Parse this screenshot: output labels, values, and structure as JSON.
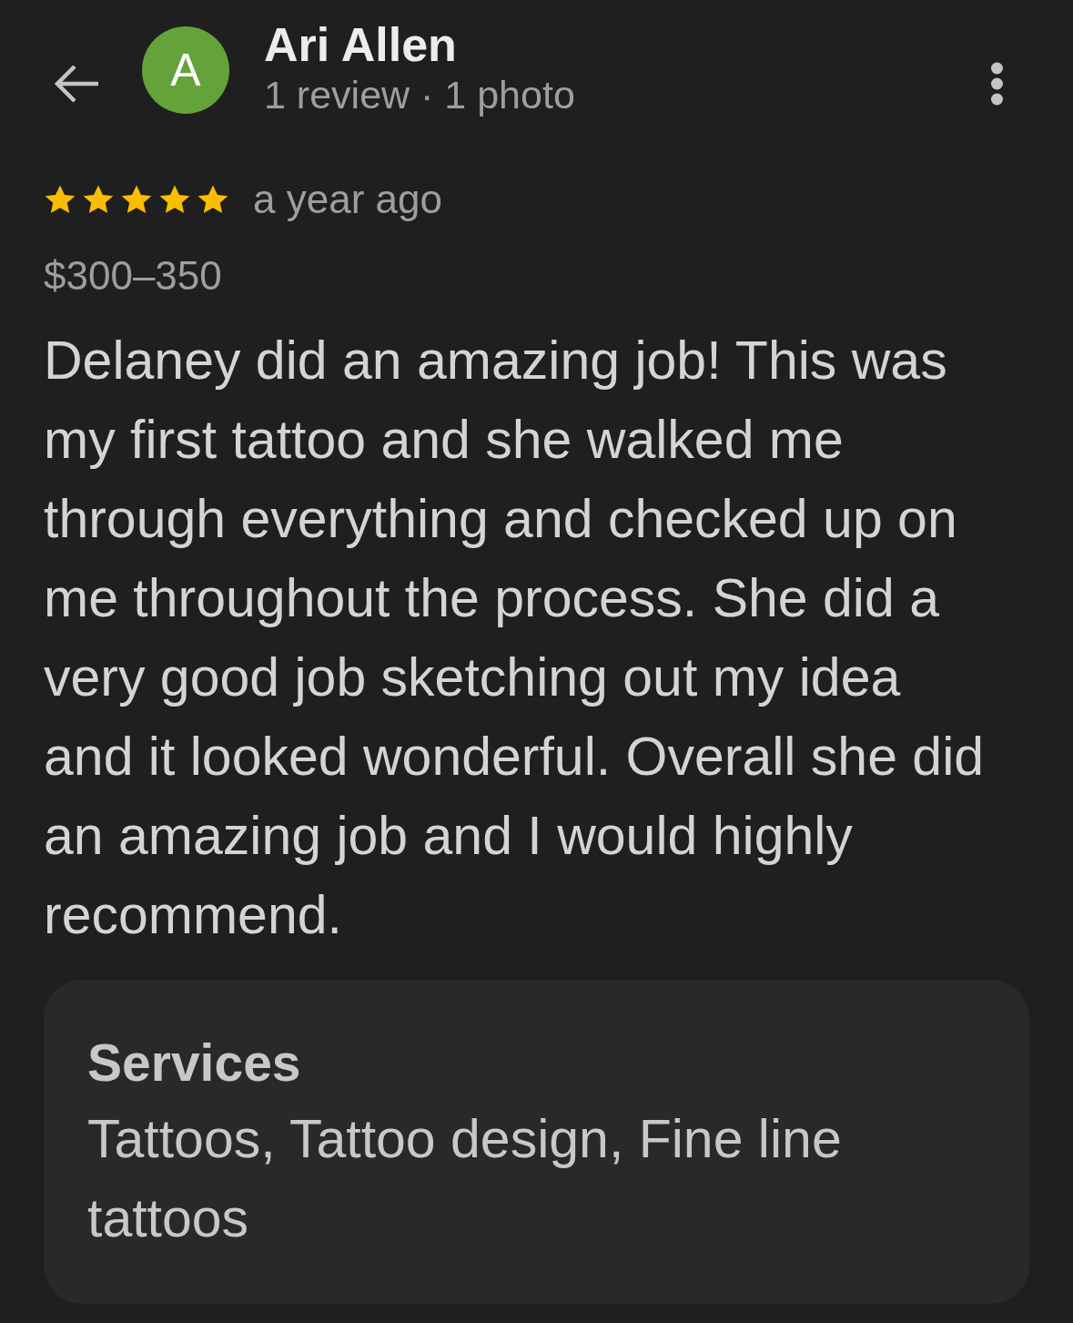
{
  "header": {
    "avatar_letter": "A",
    "name": "Ari Allen",
    "subtitle": "1 review · 1 photo"
  },
  "review": {
    "stars": 5,
    "time": "a year ago",
    "price": "$300–350",
    "text": "Delaney did an amazing job! This was my first tattoo and she walked me through everything and checked up on me throughout the process. She did a very good job sketching out my idea and it looked wonderful. Overall she did an amazing job and I would highly recommend."
  },
  "services": {
    "heading": "Services",
    "text": "Tattoos, Tattoo design, Fine line tattoos"
  }
}
